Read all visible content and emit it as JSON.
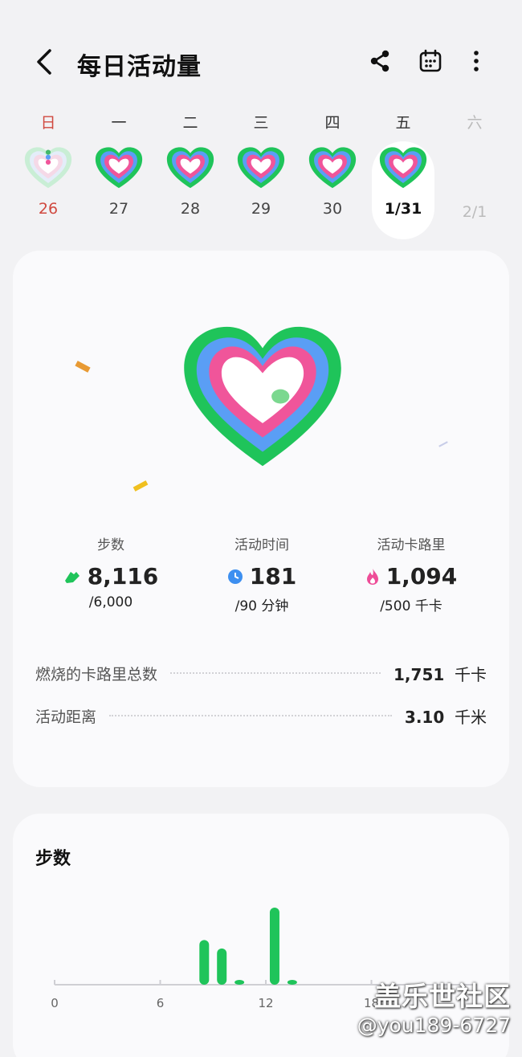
{
  "header": {
    "title": "每日活动量",
    "icons": [
      "back-icon",
      "share-icon",
      "calendar-icon",
      "more-vertical-icon"
    ]
  },
  "week": [
    {
      "label": "日",
      "date": "26"
    },
    {
      "label": "一",
      "date": "27"
    },
    {
      "label": "二",
      "date": "28"
    },
    {
      "label": "三",
      "date": "29"
    },
    {
      "label": "四",
      "date": "30"
    },
    {
      "label": "五",
      "date": "1/31"
    },
    {
      "label": "六",
      "date": "2/1"
    }
  ],
  "summary": {
    "steps": {
      "label": "步数",
      "value": "8,116",
      "goal": "/6,000",
      "icon": "shoe-icon"
    },
    "active_time": {
      "label": "活动时间",
      "value": "181",
      "goal": "/90 分钟",
      "icon": "clock-icon"
    },
    "calories": {
      "label": "活动卡路里",
      "value": "1,094",
      "goal": "/500 千卡",
      "icon": "flame-icon"
    },
    "total_burned": {
      "label": "燃烧的卡路里总数",
      "value": "1,751",
      "unit": "千卡"
    },
    "distance": {
      "label": "活动距离",
      "value": "3.10",
      "unit": "千米"
    }
  },
  "steps_card": {
    "title": "步数"
  },
  "colors": {
    "green": "#1fc45a",
    "blue": "#5a9ef5",
    "pink": "#f0559a",
    "sunday": "#d0493f"
  },
  "chart_data": {
    "type": "bar",
    "title": "步数",
    "x": [
      8,
      9,
      10,
      12,
      13
    ],
    "values": [
      0.58,
      0.47,
      0.05,
      1.0,
      0.05
    ],
    "xticks": [
      "0",
      "6",
      "12",
      "18"
    ],
    "xlim": [
      0,
      24
    ],
    "ylim": [
      0,
      1
    ]
  },
  "watermark": {
    "line1": "盖乐世社区",
    "line2": "@you189-6727"
  }
}
